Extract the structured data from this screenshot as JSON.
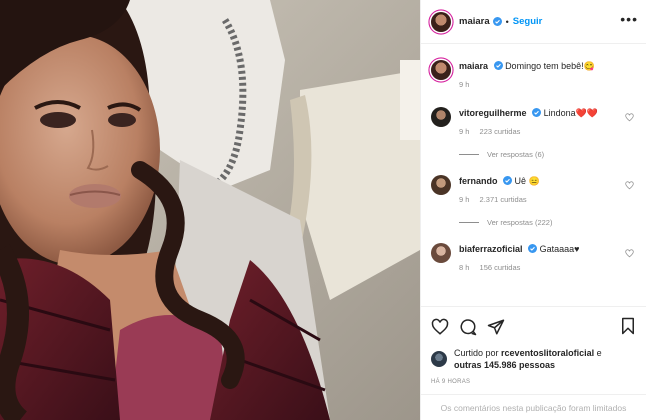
{
  "post": {
    "username": "maiara",
    "follow_label": "Seguir",
    "separator": "•",
    "more_label": "•••"
  },
  "caption": {
    "username": "maiara",
    "text": "Domingo tem bebê!😋",
    "time": "9 h"
  },
  "comments": [
    {
      "username": "vitoreguilherme",
      "text": "Lindona❤️❤️",
      "time": "9 h",
      "likes": "223 curtidas",
      "replies": "Ver respostas (6)"
    },
    {
      "username": "fernando",
      "text": "Uê 😑",
      "time": "9 h",
      "likes": "2.371 curtidas",
      "replies": "Ver respostas (222)"
    },
    {
      "username": "biaferrazoficial",
      "text": "Gataaaa♥",
      "time": "8 h",
      "likes": "156 curtidas"
    }
  ],
  "likes": {
    "prefix": "Curtido por",
    "user": "rceventoslitoraloficial",
    "conj": "e",
    "others": "outras 145.986 pessoas"
  },
  "posted_ago": "HÁ 9 HORAS",
  "comments_limited": "Os comentários nesta publicação foram limitados",
  "colors": {
    "accent": "#0095f6",
    "verified": "#3897f0",
    "heart": "#ed4956"
  },
  "icons": [
    "verified-badge-icon",
    "more-icon",
    "heart-icon",
    "comment-icon",
    "share-icon",
    "bookmark-icon"
  ]
}
